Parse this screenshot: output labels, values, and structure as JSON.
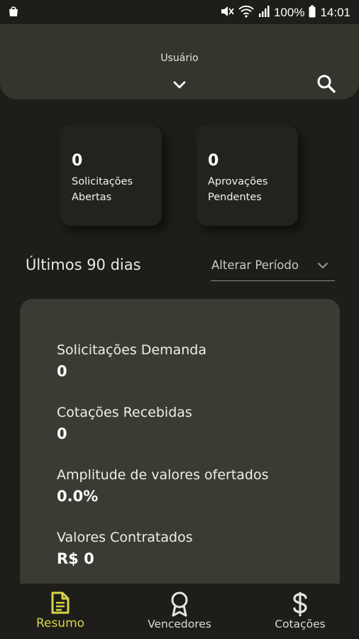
{
  "status_bar": {
    "battery": "100%",
    "time": "14:01",
    "icons": [
      "bag-icon",
      "mute-icon",
      "wifi-icon",
      "signal-icon",
      "battery-icon"
    ]
  },
  "header": {
    "title": "Usuário",
    "icons": [
      "chevron-down-icon",
      "search-icon"
    ]
  },
  "cards": [
    {
      "count": "0",
      "label_line1": "Solicitações",
      "label_line2": "Abertas"
    },
    {
      "count": "0",
      "label_line1": "Aprovações",
      "label_line2": "Pendentes"
    }
  ],
  "period": {
    "title": "Últimos 90 dias",
    "select_label": "Alterar Período"
  },
  "stats": [
    {
      "label": "Solicitações Demanda",
      "value": "0"
    },
    {
      "label": "Cotações Recebidas",
      "value": "0"
    },
    {
      "label": "Amplitude de valores ofertados",
      "value": "0.0%"
    },
    {
      "label": "Valores Contratados",
      "value": "R$ 0"
    }
  ],
  "bottom_nav": [
    {
      "label": "Resumo",
      "icon": "document-icon",
      "active": true
    },
    {
      "label": "Vencedores",
      "icon": "award-icon",
      "active": false
    },
    {
      "label": "Cotações",
      "icon": "dollar-icon",
      "active": false
    }
  ],
  "colors": {
    "background": "#1e1d19",
    "header": "#35342d",
    "panel": "#3b3a33",
    "accent": "#d8d44a"
  }
}
